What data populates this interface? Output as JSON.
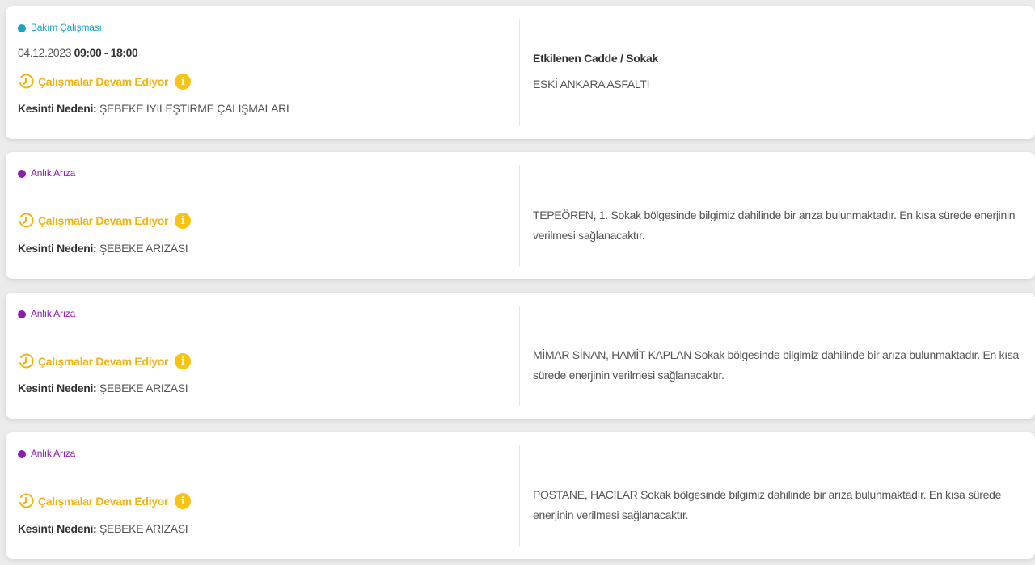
{
  "outages": [
    {
      "type_label": "Bakım Çalışması",
      "type_color": "#1aa3c8",
      "date": "04.12.2023",
      "time_range": "09:00 - 18:00",
      "status_label": "Çalışmalar Devam Ediyor",
      "reason_label": "Kesinti Nedeni:",
      "reason_value": "ŞEBEKE İYİLEŞTİRME ÇALIŞMALARI",
      "affected_title": "Etkilenen Cadde / Sokak",
      "affected_text": "ESKİ ANKARA ASFALTI"
    },
    {
      "type_label": "Anlık Arıza",
      "type_color": "#8e1cb0",
      "status_label": "Çalışmalar Devam Ediyor",
      "reason_label": "Kesinti Nedeni:",
      "reason_value": "ŞEBEKE ARIZASI",
      "affected_text": "TEPEÖREN, 1. Sokak bölgesinde bilgimiz dahilinde bir arıza bulunmaktadır. En kısa sürede enerjinin verilmesi sağlanacaktır."
    },
    {
      "type_label": "Anlık Arıza",
      "type_color": "#8e1cb0",
      "status_label": "Çalışmalar Devam Ediyor",
      "reason_label": "Kesinti Nedeni:",
      "reason_value": "ŞEBEKE ARIZASI",
      "affected_text": "MİMAR SİNAN, HAMİT KAPLAN Sokak bölgesinde bilgimiz dahilinde bir arıza bulunmaktadır. En kısa sürede enerjinin verilmesi sağlanacaktır."
    },
    {
      "type_label": "Anlık Arıza",
      "type_color": "#8e1cb0",
      "status_label": "Çalışmalar Devam Ediyor",
      "reason_label": "Kesinti Nedeni:",
      "reason_value": "ŞEBEKE ARIZASI",
      "affected_text": "POSTANE, HACILAR Sokak bölgesinde bilgimiz dahilinde bir arıza bulunmaktadır. En kısa sürede enerjinin verilmesi sağlanacaktır."
    }
  ],
  "icons": {
    "status": "clock-progress-icon",
    "info": "info-circle-icon"
  },
  "colors": {
    "status": "#f2b312",
    "info_badge": "#f7c413"
  }
}
